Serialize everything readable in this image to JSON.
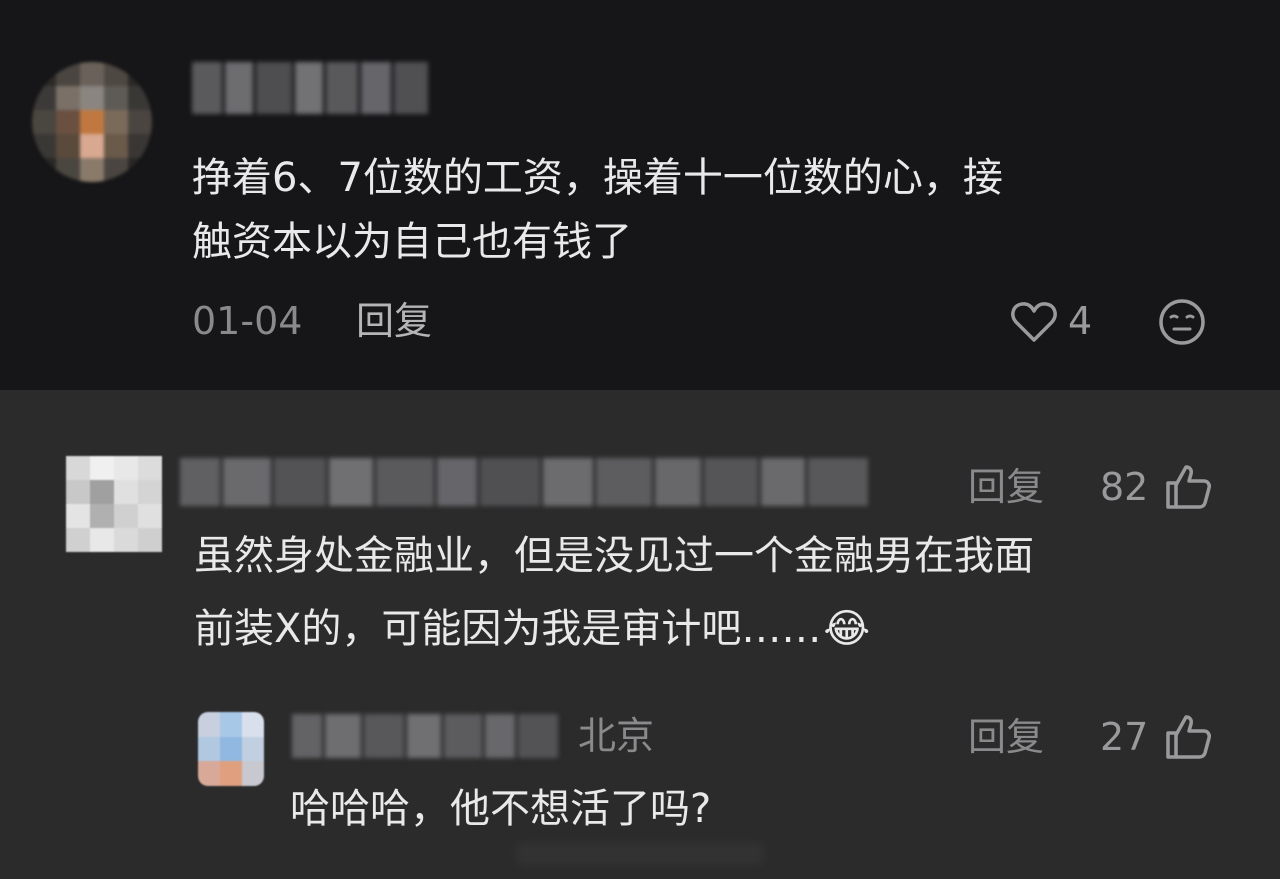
{
  "comment_1": {
    "text_line_1": "挣着6、7位数的工资，操着十一位数的心，接",
    "text_line_2": "触资本以为自己也有钱了",
    "date": "01-04",
    "reply_label": "回复",
    "like_count": "4"
  },
  "comment_2": {
    "text_line_1": "虽然身处金融业，但是没见过一个金融男在我面",
    "text_line_2": "前装X的，可能因为我是审计吧……",
    "emoji": "😂",
    "reply_label": "回复",
    "like_count": "82"
  },
  "comment_3": {
    "location": "北京",
    "text": "哈哈哈，他不想活了吗?",
    "reply_label": "回复",
    "like_count": "27"
  },
  "icons": {
    "heart": "heart-outline-icon",
    "emoji": "neutral-face-icon",
    "thumbs_up": "thumbs-up-outline-icon"
  },
  "colors": {
    "top_background": "#161618",
    "bottom_background": "#2b2b2b",
    "primary_text": "#e9e9ea",
    "secondary_text": "#8a8a8c"
  }
}
